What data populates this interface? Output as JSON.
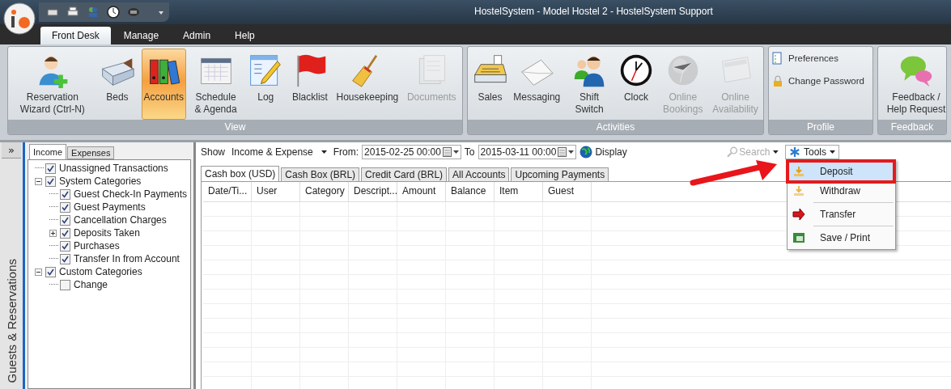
{
  "window": {
    "title": "HostelSystem - Model Hostel 2 - HostelSystem Support"
  },
  "menu_tabs": [
    {
      "label": "Front Desk",
      "selected": true
    },
    {
      "label": "Manage",
      "selected": false
    },
    {
      "label": "Admin",
      "selected": false
    },
    {
      "label": "Help",
      "selected": false
    }
  ],
  "ribbon": {
    "groups": [
      {
        "label": "View",
        "items": [
          {
            "label": "Reservation Wizard (Ctrl-N)",
            "selected": false,
            "disabled": false
          },
          {
            "label": "Beds",
            "selected": false,
            "disabled": false
          },
          {
            "label": "Accounts",
            "selected": true,
            "disabled": false
          },
          {
            "label": "Schedule & Agenda",
            "selected": false,
            "disabled": false
          },
          {
            "label": "Log",
            "selected": false,
            "disabled": false
          },
          {
            "label": "Blacklist",
            "selected": false,
            "disabled": false
          },
          {
            "label": "Housekeeping",
            "selected": false,
            "disabled": false
          },
          {
            "label": "Documents",
            "selected": false,
            "disabled": true
          }
        ]
      },
      {
        "label": "Activities",
        "items": [
          {
            "label": "Sales",
            "selected": false,
            "disabled": false
          },
          {
            "label": "Messaging",
            "selected": false,
            "disabled": false
          },
          {
            "label": "Shift Switch",
            "selected": false,
            "disabled": false
          },
          {
            "label": "Clock",
            "selected": false,
            "disabled": false
          },
          {
            "label": "Online Bookings",
            "selected": false,
            "disabled": true
          },
          {
            "label": "Online Availability",
            "selected": false,
            "disabled": true
          }
        ]
      },
      {
        "label": "Profile",
        "kind": "small",
        "items": [
          {
            "label": "Preferences",
            "selected": false,
            "disabled": false
          },
          {
            "label": "Change Password",
            "selected": false,
            "disabled": false
          }
        ]
      },
      {
        "label": "Feedback",
        "items": [
          {
            "label": "Feedback / Help Request",
            "selected": false,
            "disabled": false
          }
        ]
      }
    ]
  },
  "side_strip": {
    "toggle": "»",
    "label": "Guests & Reservations"
  },
  "category_tabs": [
    {
      "label": "Income",
      "selected": true
    },
    {
      "label": "Expenses",
      "selected": false
    }
  ],
  "category_tree": [
    {
      "label": "Unassigned Transactions",
      "checked": true
    },
    {
      "label": "System Categories",
      "checked": true,
      "expanded": true,
      "children": [
        {
          "label": "Guest Check-In Payments",
          "checked": true
        },
        {
          "label": "Guest Payments",
          "checked": true
        },
        {
          "label": "Cancellation Charges",
          "checked": true
        },
        {
          "label": "Deposits Taken",
          "checked": true,
          "expanded": false
        },
        {
          "label": "Purchases",
          "checked": true
        },
        {
          "label": "Transfer In from Account",
          "checked": true
        }
      ]
    },
    {
      "label": "Custom Categories",
      "checked": true,
      "expanded": true,
      "children": [
        {
          "label": "Change",
          "checked": false
        }
      ]
    }
  ],
  "filter_bar": {
    "show_label": "Show",
    "show_value": "Income & Expense",
    "from_label": "From:",
    "from_value": "2015-02-25 00:00",
    "to_label": "To",
    "to_value": "2015-03-11 00:00",
    "display_button": "Display",
    "search_placeholder": "Search",
    "tools_button": "Tools"
  },
  "account_tabs": [
    {
      "label": "Cash box (USD)",
      "selected": true
    },
    {
      "label": "Cash Box (BRL)",
      "selected": false
    },
    {
      "label": "Credit Card (BRL)",
      "selected": false
    },
    {
      "label": "All Accounts",
      "selected": false
    },
    {
      "label": "Upcoming Payments",
      "selected": false
    }
  ],
  "table": {
    "columns": [
      "Date/Ti...",
      "User",
      "Category",
      "Descript...",
      "Amount",
      "Balance",
      "Item",
      "Guest"
    ]
  },
  "tools_menu": {
    "items": [
      {
        "label": "Deposit",
        "selected": true
      },
      {
        "label": "Withdraw",
        "selected": false
      },
      {
        "label": "Transfer",
        "selected": false
      },
      {
        "label": "Save / Print",
        "selected": false
      }
    ]
  }
}
